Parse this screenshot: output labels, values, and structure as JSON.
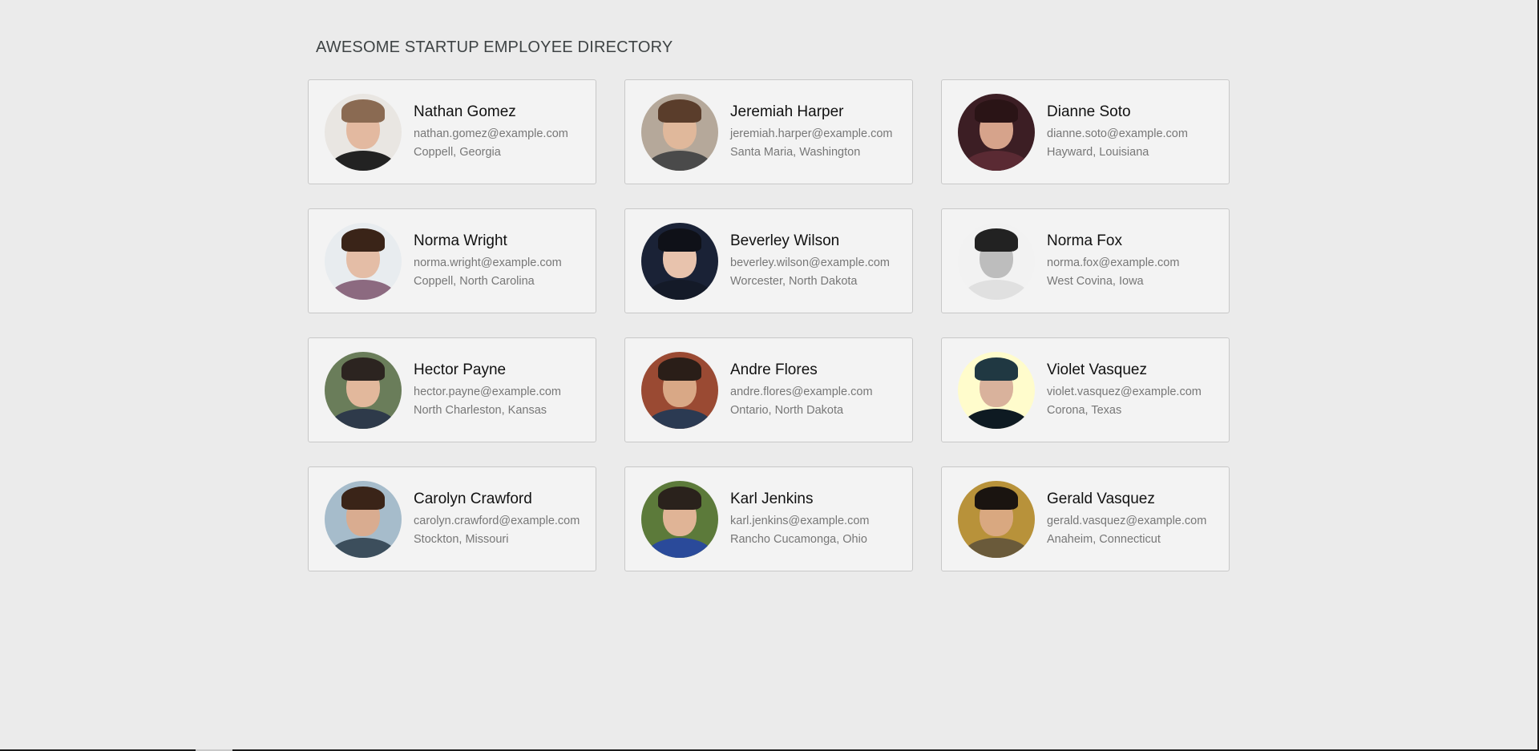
{
  "page": {
    "title": "AWESOME STARTUP EMPLOYEE DIRECTORY"
  },
  "employees": [
    {
      "name": "Nathan Gomez",
      "email": "nathan.gomez@example.com",
      "location": "Coppell, Georgia",
      "avatar": {
        "bg": "#e9e6e2",
        "skin": "#e3b9a0",
        "hair": "#8a6a52",
        "shirt": "#222222"
      }
    },
    {
      "name": "Jeremiah Harper",
      "email": "jeremiah.harper@example.com",
      "location": "Santa Maria, Washington",
      "avatar": {
        "bg": "#b5a89a",
        "skin": "#e0b89b",
        "hair": "#5a3d2b",
        "shirt": "#4a4a4a"
      }
    },
    {
      "name": "Dianne Soto",
      "email": "dianne.soto@example.com",
      "location": "Hayward, Louisiana",
      "avatar": {
        "bg": "#3c1e24",
        "skin": "#d6a38b",
        "hair": "#2a1416",
        "shirt": "#5a2a33"
      }
    },
    {
      "name": "Norma Wright",
      "email": "norma.wright@example.com",
      "location": "Coppell, North Carolina",
      "avatar": {
        "bg": "#e8ecef",
        "skin": "#e4bda6",
        "hair": "#3a2418",
        "shirt": "#8c6a80"
      }
    },
    {
      "name": "Beverley Wilson",
      "email": "beverley.wilson@example.com",
      "location": "Worcester, North Dakota",
      "avatar": {
        "bg": "#1a2236",
        "skin": "#e8c3ad",
        "hair": "#0f1118",
        "shirt": "#141a28"
      }
    },
    {
      "name": "Norma Fox",
      "email": "norma.fox@example.com",
      "location": "West Covina, Iowa",
      "avatar": {
        "bg": "#f2f2f2",
        "skin": "#bdbdbd",
        "hair": "#222222",
        "shirt": "#e0e0e0"
      }
    },
    {
      "name": "Hector Payne",
      "email": "hector.payne@example.com",
      "location": "North Charleston, Kansas",
      "avatar": {
        "bg": "#6a7d5a",
        "skin": "#e2b89c",
        "hair": "#2c2420",
        "shirt": "#2e3a4a"
      }
    },
    {
      "name": "Andre Flores",
      "email": "andre.flores@example.com",
      "location": "Ontario, North Dakota",
      "avatar": {
        "bg": "#9a4a33",
        "skin": "#d9a886",
        "hair": "#2a1e18",
        "shirt": "#2b3a52"
      }
    },
    {
      "name": "Violet Vasquez",
      "email": "violet.vasquez@example.com",
      "location": "Corona, Texas",
      "avatar": {
        "bg": "#fffccc",
        "skin": "#d9b29c",
        "hair": "#203842",
        "shirt": "#0e1a22"
      }
    },
    {
      "name": "Carolyn Crawford",
      "email": "carolyn.crawford@example.com",
      "location": "Stockton, Missouri",
      "avatar": {
        "bg": "#a6bccb",
        "skin": "#d9ac90",
        "hair": "#3a2418",
        "shirt": "#3c4e5c"
      }
    },
    {
      "name": "Karl Jenkins",
      "email": "karl.jenkins@example.com",
      "location": "Rancho Cucamonga, Ohio",
      "avatar": {
        "bg": "#5c7a3a",
        "skin": "#e0b496",
        "hair": "#2a221c",
        "shirt": "#2a4a9a"
      }
    },
    {
      "name": "Gerald Vasquez",
      "email": "gerald.vasquez@example.com",
      "location": "Anaheim, Connecticut",
      "avatar": {
        "bg": "#b8923a",
        "skin": "#d9a880",
        "hair": "#1a1410",
        "shirt": "#6a5a3a"
      }
    }
  ],
  "colors": {
    "background": "#ebebeb",
    "card_background": "#f3f3f3",
    "card_border": "#c8c8c8",
    "title": "#3e4344",
    "name": "#111111",
    "secondary_text": "#777777"
  }
}
